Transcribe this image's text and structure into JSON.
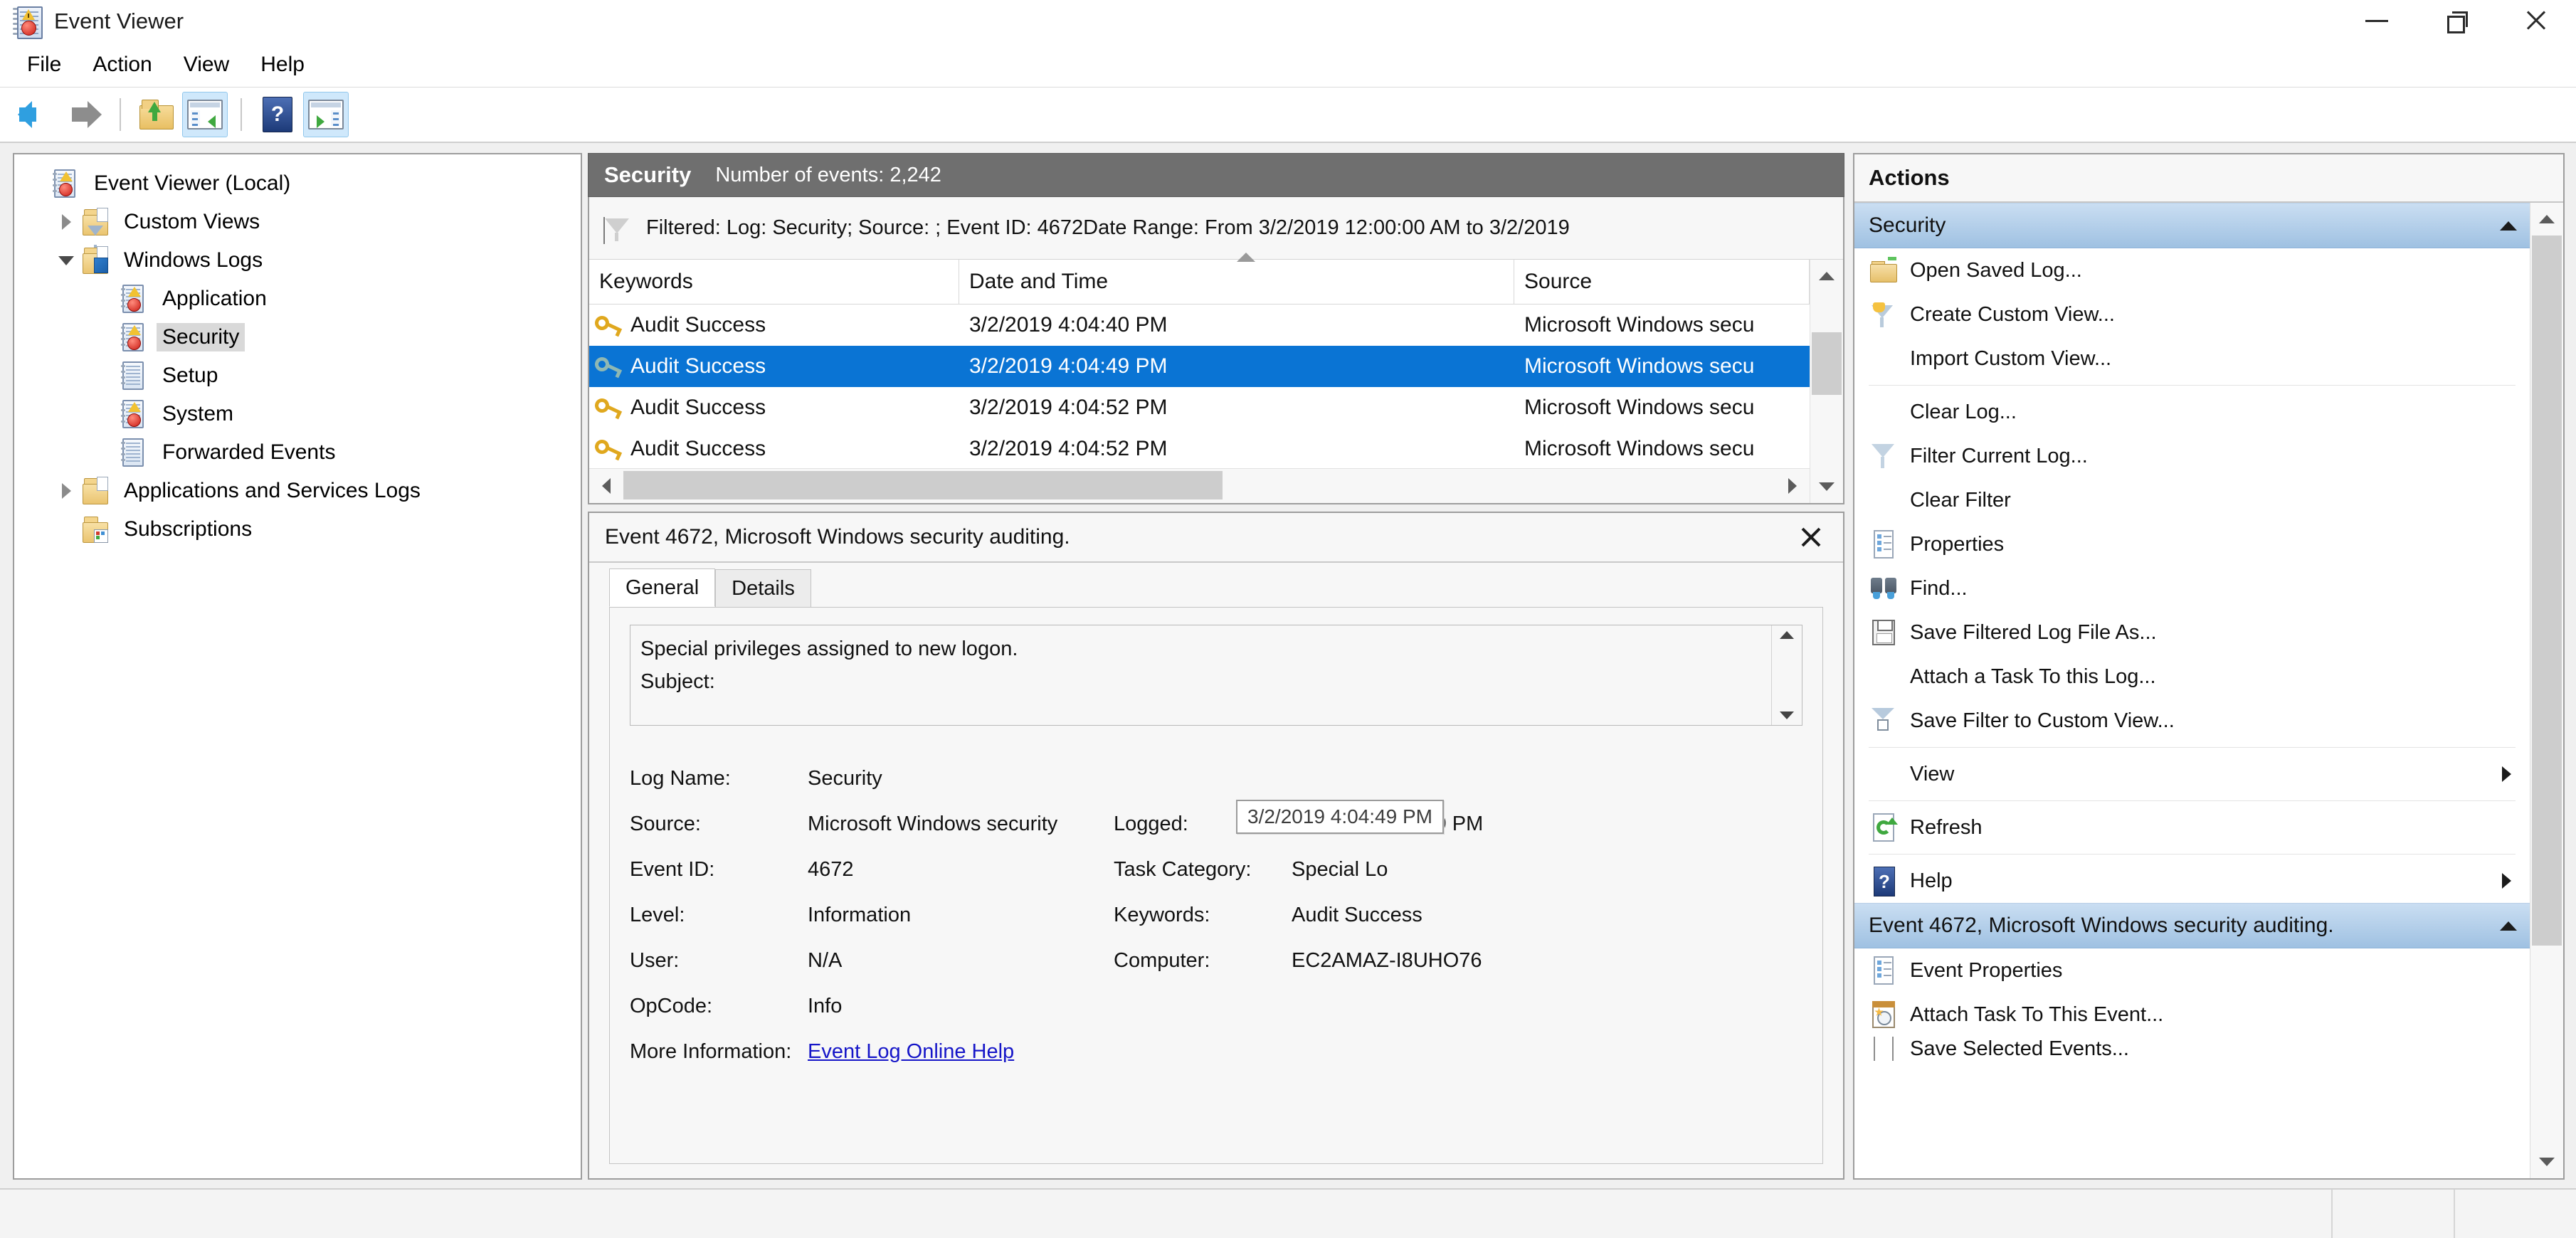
{
  "window": {
    "title": "Event Viewer",
    "app_icon": "event-viewer-icon",
    "controls": {
      "minimize": "minimize-icon",
      "restore": "restore-icon",
      "close": "close-icon"
    }
  },
  "menubar": {
    "items": [
      "File",
      "Action",
      "View",
      "Help"
    ]
  },
  "toolbar": {
    "buttons": [
      {
        "name": "back-button",
        "icon": "back-arrow-icon",
        "pressed": false
      },
      {
        "name": "forward-button",
        "icon": "forward-arrow-icon",
        "pressed": false
      },
      {
        "name": "up-one-level-button",
        "icon": "folder-up-icon",
        "pressed": false
      },
      {
        "name": "show-hide-console-tree-button",
        "icon": "console-tree-icon",
        "pressed": true
      },
      {
        "name": "help-button",
        "icon": "help-question-icon",
        "pressed": false
      },
      {
        "name": "show-hide-action-pane-button",
        "icon": "action-pane-icon",
        "pressed": true
      }
    ]
  },
  "tree": {
    "root": {
      "label": "Event Viewer (Local)",
      "icon": "event-viewer-icon"
    },
    "items": [
      {
        "label": "Custom Views",
        "icon": "custom-views-folder-icon",
        "expander": "collapsed",
        "indent": 1,
        "selected": false
      },
      {
        "label": "Windows Logs",
        "icon": "windows-logs-folder-icon",
        "expander": "expanded",
        "indent": 1,
        "selected": false
      },
      {
        "label": "Application",
        "icon": "log-warning-icon",
        "expander": "none",
        "indent": 2,
        "selected": false
      },
      {
        "label": "Security",
        "icon": "log-warning-icon",
        "expander": "none",
        "indent": 2,
        "selected": true
      },
      {
        "label": "Setup",
        "icon": "log-plain-icon",
        "expander": "none",
        "indent": 2,
        "selected": false
      },
      {
        "label": "System",
        "icon": "log-warning-icon",
        "expander": "none",
        "indent": 2,
        "selected": false
      },
      {
        "label": "Forwarded Events",
        "icon": "log-plain-icon",
        "expander": "none",
        "indent": 2,
        "selected": false
      },
      {
        "label": "Applications and Services Logs",
        "icon": "apps-services-folder-icon",
        "expander": "collapsed",
        "indent": 1,
        "selected": false
      },
      {
        "label": "Subscriptions",
        "icon": "subscriptions-folder-icon",
        "expander": "none",
        "indent": 1,
        "selected": false
      }
    ]
  },
  "list_header": {
    "log_name": "Security",
    "event_count": "Number of events: 2,242"
  },
  "filter_bar": {
    "icon": "filter-funnel-icon",
    "text": "Filtered: Log: Security; Source: ; Event ID: 4672Date Range: From 3/2/2019 12:00:00 AM to 3/2/2019"
  },
  "event_list": {
    "columns": [
      "Keywords",
      "Date and Time",
      "Source"
    ],
    "sorted_column": "Date and Time",
    "sort_direction": "ascending",
    "rows": [
      {
        "keywords": "Audit Success",
        "datetime": "3/2/2019 4:04:40 PM",
        "source": "Microsoft Windows secu",
        "selected": false
      },
      {
        "keywords": "Audit Success",
        "datetime": "3/2/2019 4:04:49 PM",
        "source": "Microsoft Windows secu",
        "selected": true
      },
      {
        "keywords": "Audit Success",
        "datetime": "3/2/2019 4:04:52 PM",
        "source": "Microsoft Windows secu",
        "selected": false
      },
      {
        "keywords": "Audit Success",
        "datetime": "3/2/2019 4:04:52 PM",
        "source": "Microsoft Windows secu",
        "selected": false
      }
    ]
  },
  "detail": {
    "title": "Event 4672, Microsoft Windows security auditing.",
    "close_icon": "close-icon",
    "tabs": [
      {
        "label": "General",
        "active": true
      },
      {
        "label": "Details",
        "active": false
      }
    ],
    "message_lines": [
      "Special privileges assigned to new logon.",
      "Subject:"
    ],
    "fields": {
      "log_name_label": "Log Name:",
      "log_name_value": "Security",
      "source_label": "Source:",
      "source_value": "Microsoft Windows security",
      "logged_label": "Logged:",
      "logged_value": "3/2/2019 4:04:49 PM",
      "event_id_label": "Event ID:",
      "event_id_value": "4672",
      "task_category_label": "Task Category:",
      "task_category_value": "Special Lo",
      "level_label": "Level:",
      "level_value": "Information",
      "keywords_label": "Keywords:",
      "keywords_value": "Audit Success",
      "user_label": "User:",
      "user_value": "N/A",
      "computer_label": "Computer:",
      "computer_value": "EC2AMAZ-I8UHO76",
      "opcode_label": "OpCode:",
      "opcode_value": "Info",
      "more_info_label": "More Information:",
      "more_info_link": "Event Log Online Help"
    },
    "tooltip": "3/2/2019 4:04:49 PM"
  },
  "actions": {
    "header": "Actions",
    "groups": [
      {
        "title": "Security",
        "collapse_icon": "caret-up-icon",
        "items": [
          {
            "label": "Open Saved Log...",
            "icon": "open-saved-log-icon",
            "submenu": false,
            "sep_after": false
          },
          {
            "label": "Create Custom View...",
            "icon": "create-custom-view-icon",
            "submenu": false,
            "sep_after": false
          },
          {
            "label": "Import Custom View...",
            "icon": "none",
            "submenu": false,
            "sep_after": true
          },
          {
            "label": "Clear Log...",
            "icon": "none",
            "submenu": false,
            "sep_after": false
          },
          {
            "label": "Filter Current Log...",
            "icon": "filter-funnel-icon",
            "submenu": false,
            "sep_after": false
          },
          {
            "label": "Clear Filter",
            "icon": "none",
            "submenu": false,
            "sep_after": false
          },
          {
            "label": "Properties",
            "icon": "properties-icon",
            "submenu": false,
            "sep_after": false
          },
          {
            "label": "Find...",
            "icon": "find-binoculars-icon",
            "submenu": false,
            "sep_after": false
          },
          {
            "label": "Save Filtered Log File As...",
            "icon": "save-disk-icon",
            "submenu": false,
            "sep_after": false
          },
          {
            "label": "Attach a Task To this Log...",
            "icon": "none",
            "submenu": false,
            "sep_after": false
          },
          {
            "label": "Save Filter to Custom View...",
            "icon": "save-filter-icon",
            "submenu": false,
            "sep_after": true
          },
          {
            "label": "View",
            "icon": "none",
            "submenu": true,
            "sep_after": true
          },
          {
            "label": "Refresh",
            "icon": "refresh-icon",
            "submenu": false,
            "sep_after": true
          },
          {
            "label": "Help",
            "icon": "help-question-icon",
            "submenu": true,
            "sep_after": false
          }
        ]
      },
      {
        "title": "Event 4672, Microsoft Windows security auditing.",
        "collapse_icon": "caret-up-icon",
        "items": [
          {
            "label": "Event Properties",
            "icon": "properties-icon",
            "submenu": false,
            "sep_after": false
          },
          {
            "label": "Attach Task To This Event...",
            "icon": "attach-task-icon",
            "submenu": false,
            "sep_after": false
          },
          {
            "label": "Save Selected Events...",
            "icon": "save-selected-events-icon",
            "submenu": false,
            "sep_after": false
          }
        ]
      }
    ]
  },
  "statusbar": {
    "text": ""
  },
  "colors": {
    "selection_blue": "#0a74d4",
    "header_gray": "#6f6f6f",
    "group_header_blue": "#9fc1e2",
    "link_blue": "#1515c8"
  }
}
